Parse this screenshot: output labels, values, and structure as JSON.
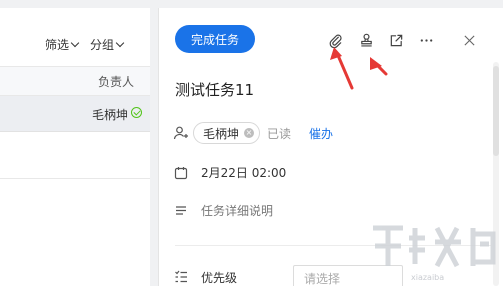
{
  "list": {
    "filter_label": "筛选",
    "group_label": "分组",
    "column_owner": "负责人",
    "selected_row_owner": "毛柄坤"
  },
  "detail": {
    "complete_button": "完成任务",
    "title": "测试任务11",
    "assignee": {
      "name": "毛柄坤",
      "read_state": "已读",
      "urge_label": "催办"
    },
    "due_date": "2月22日 02:00",
    "description_placeholder": "任务详细说明",
    "priority_label": "优先级",
    "priority_placeholder": "请选择"
  },
  "icons": [
    "attachment-icon",
    "stamp-icon",
    "open-new-window-icon",
    "more-icon",
    "close-icon",
    "add-user-icon",
    "calendar-icon",
    "description-icon",
    "priority-icon",
    "check-circle-icon"
  ],
  "colors": {
    "primary": "#1a73e8",
    "arrow": "#e53935",
    "read_check": "#52c41a"
  },
  "watermark": "xiazaiba"
}
